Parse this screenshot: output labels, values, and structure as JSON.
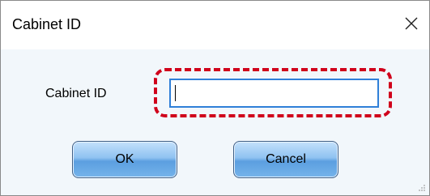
{
  "window": {
    "title": "Cabinet ID",
    "close_icon": "close-icon"
  },
  "form": {
    "label": "Cabinet ID",
    "input_value": "",
    "input_placeholder": "",
    "highlight_color": "#d0021b"
  },
  "buttons": {
    "ok_label": "OK",
    "cancel_label": "Cancel"
  },
  "colors": {
    "client_background": "#f2f7fb",
    "input_border": "#2f7fd8",
    "button_top": "#c4e1fb",
    "button_bottom": "#5b9fe0"
  }
}
